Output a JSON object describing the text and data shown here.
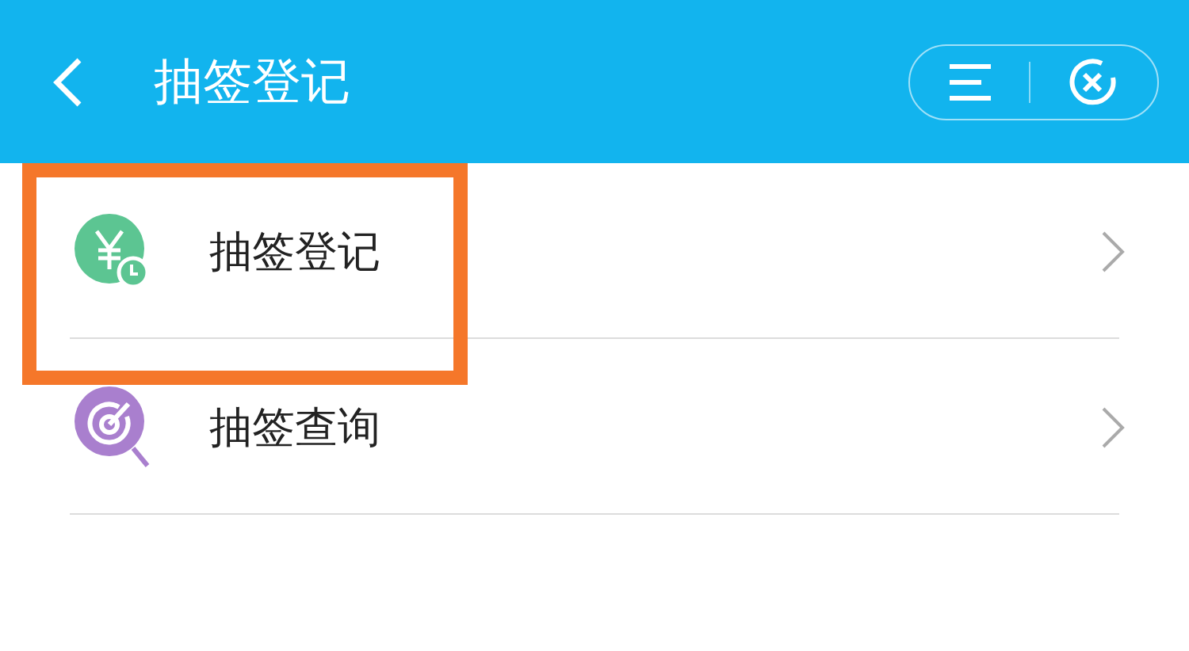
{
  "header": {
    "title": "抽签登记"
  },
  "items": [
    {
      "label": "抽签登记",
      "kind": "yen",
      "highlighted": true
    },
    {
      "label": "抽签查询",
      "kind": "target",
      "highlighted": false
    }
  ]
}
